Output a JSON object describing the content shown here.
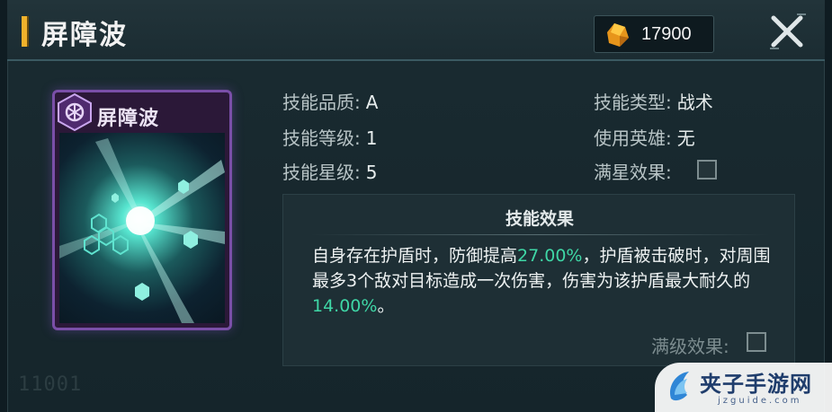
{
  "header": {
    "title": "屏障波",
    "currency_value": "17900",
    "icons": {
      "currency": "orange-crystal-icon",
      "close": "close-x-icon"
    }
  },
  "card": {
    "name": "屏障波",
    "icon": "hexagon-shield-icon",
    "accent_color": "#7a4fa8"
  },
  "stats_left": [
    {
      "label": "技能品质:",
      "value": "A"
    },
    {
      "label": "技能等级:",
      "value": "1"
    },
    {
      "label": "技能星级:",
      "value": "5"
    }
  ],
  "stats_right": [
    {
      "label": "技能类型:",
      "value": "战术"
    },
    {
      "label": "使用英雄:",
      "value": "无"
    },
    {
      "label": "满星效果:",
      "value": ""
    }
  ],
  "effect": {
    "title": "技能效果",
    "text_1": "自身存在护盾时，防御提高",
    "value_1": "27.00%",
    "text_2": "，护盾被击破时，对周围最多3个敌对目标造成一次伤害，伤害为该护盾最大耐久的",
    "value_2": "14.00%",
    "text_3": "。",
    "highlight_color": "#3fd7a6"
  },
  "max_level": {
    "label": "满级效果:"
  },
  "serial": "11001",
  "watermark": {
    "text": "夹子手游网",
    "sub": "jzguide.com"
  }
}
